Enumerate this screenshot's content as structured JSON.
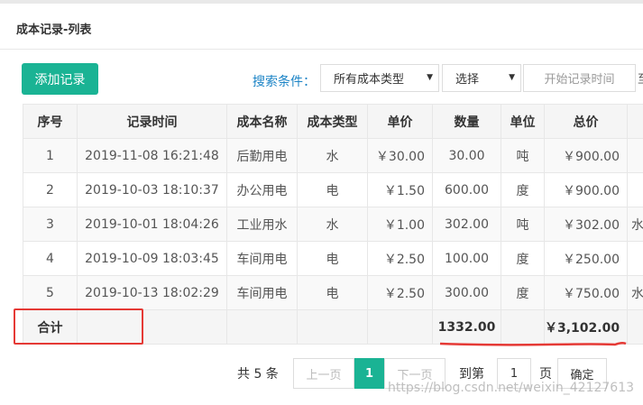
{
  "panel": {
    "title": "成本记录-列表"
  },
  "toolbar": {
    "add_label": "添加记录",
    "search_label": "搜索条件：",
    "type_select": "所有成本类型",
    "choose_select": "选择",
    "start_time_placeholder": "开始记录时间",
    "clipped_char": "至"
  },
  "table": {
    "columns": [
      "序号",
      "记录时间",
      "成本名称",
      "成本类型",
      "单价",
      "数量",
      "单位",
      "总价"
    ],
    "rows": [
      {
        "no": "1",
        "time": "2019-11-08 16:21:48",
        "name": "后勤用电",
        "type": "水",
        "price": "￥30.00",
        "qty": "30.00",
        "unit": "吨",
        "total": "￥900.00",
        "extra": ""
      },
      {
        "no": "2",
        "time": "2019-10-03 18:10:37",
        "name": "办公用电",
        "type": "电",
        "price": "￥1.50",
        "qty": "600.00",
        "unit": "度",
        "total": "￥900.00",
        "extra": ""
      },
      {
        "no": "3",
        "time": "2019-10-01 18:04:26",
        "name": "工业用水",
        "type": "水",
        "price": "￥1.00",
        "qty": "302.00",
        "unit": "吨",
        "total": "￥302.00",
        "extra": "水"
      },
      {
        "no": "4",
        "time": "2019-10-09 18:03:45",
        "name": "车间用电",
        "type": "电",
        "price": "￥2.50",
        "qty": "100.00",
        "unit": "度",
        "total": "￥250.00",
        "extra": ""
      },
      {
        "no": "5",
        "time": "2019-10-13 18:02:29",
        "name": "车间用电",
        "type": "电",
        "price": "￥2.50",
        "qty": "300.00",
        "unit": "度",
        "total": "￥750.00",
        "extra": "水"
      }
    ],
    "total_row": {
      "label": "合计",
      "qty": "1332.00",
      "total": "￥3,102.00"
    }
  },
  "pagination": {
    "total_text": "共 5 条",
    "prev": "上一页",
    "current": "1",
    "next": "下一页",
    "goto_label": "到第",
    "goto_value": "1",
    "page_label": "页",
    "confirm": "确定"
  },
  "watermark": "https://blog.csdn.net/weixin_42127613",
  "colors": {
    "accent": "#1ab394",
    "link": "#1c84c6",
    "annotation_red": "#e53935"
  }
}
